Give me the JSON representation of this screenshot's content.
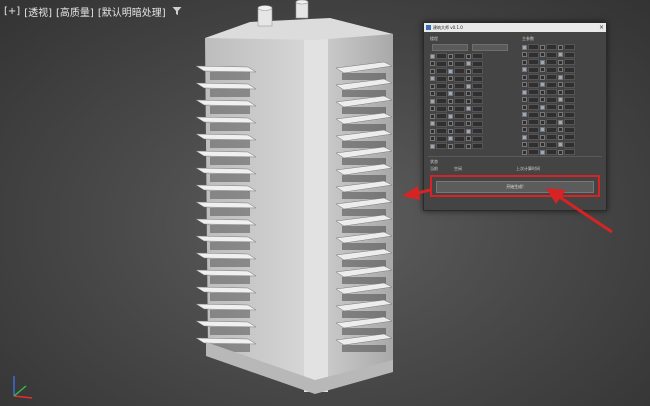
{
  "viewport": {
    "labels": [
      "[+]",
      "[透视]",
      "[高质量]",
      "[默认明暗处理]"
    ],
    "filter_icon": "filter-icon",
    "axis_icon": "axis-gizmo-icon",
    "colors": {
      "axis_x": "#e03030",
      "axis_y": "#30c040",
      "axis_z": "#3a6fe0"
    }
  },
  "dialog": {
    "title": "建筑大师 v0.1.0",
    "close_label": "×",
    "left_section_label": "楼程",
    "right_section_label": "主参数",
    "generate_label": "开始生成!",
    "status_label": "状态",
    "current_label": "当前",
    "current_value": "空闲",
    "last_label": "上次计算时间"
  },
  "annotation": {
    "color": "#d62323"
  }
}
